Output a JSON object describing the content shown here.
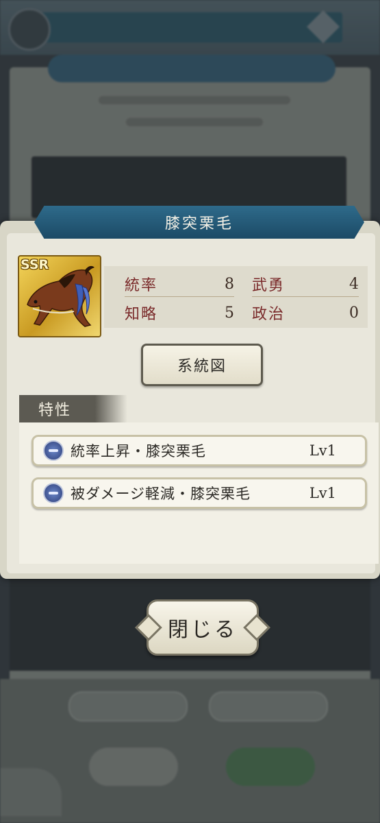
{
  "title": "膝突栗毛",
  "portrait": {
    "rarity": "SSR",
    "icon": "horse-portrait-icon"
  },
  "stats": {
    "leadership": {
      "label": "統率",
      "value": "8"
    },
    "valor": {
      "label": "武勇",
      "value": "4"
    },
    "intellect": {
      "label": "知略",
      "value": "5"
    },
    "politics": {
      "label": "政治",
      "value": "0"
    }
  },
  "lineage_button": "系統図",
  "traits": {
    "header": "特性",
    "items": [
      {
        "name": "統率上昇・膝突栗毛",
        "level": "Lv1"
      },
      {
        "name": "被ダメージ軽減・膝突栗毛",
        "level": "Lv1"
      }
    ]
  },
  "close_button": "閉じる",
  "colors": {
    "banner": "#1c4a66",
    "rarity_frame": "#c99a22",
    "stat_label": "#7a2a2a"
  }
}
